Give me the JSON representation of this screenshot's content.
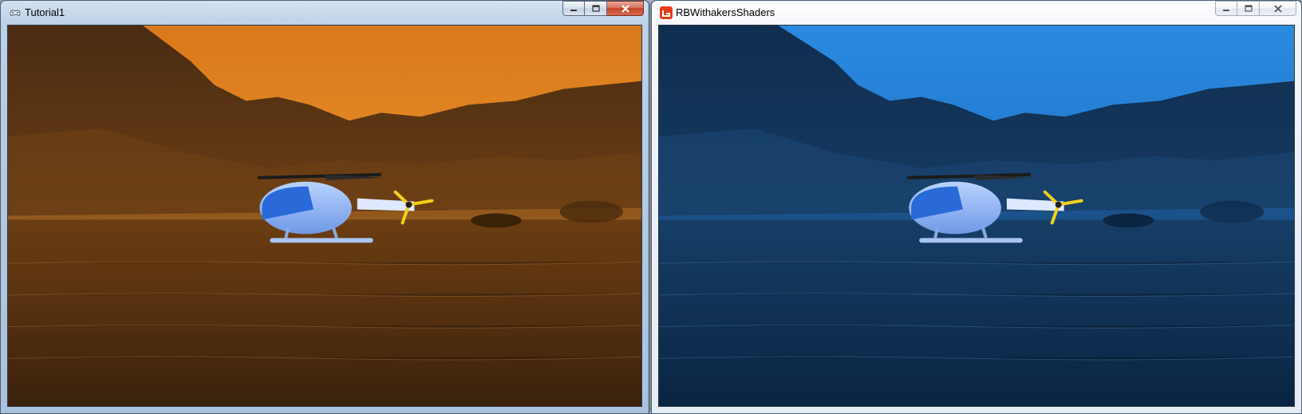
{
  "windows": [
    {
      "title": "Tutorial1",
      "icon": "gamepad-icon",
      "scene": "orange-sunset-lake-with-helicopter"
    },
    {
      "title": "RBWithakersShaders",
      "icon": "monogame-icon",
      "scene": "blue-lake-with-helicopter"
    }
  ],
  "colors": {
    "left_sky_top": "#e58a25",
    "left_water": "#4a2a0d",
    "right_sky_top": "#2f8de3",
    "right_water": "#0e2c4c",
    "monogame_red": "#e73c1e"
  }
}
